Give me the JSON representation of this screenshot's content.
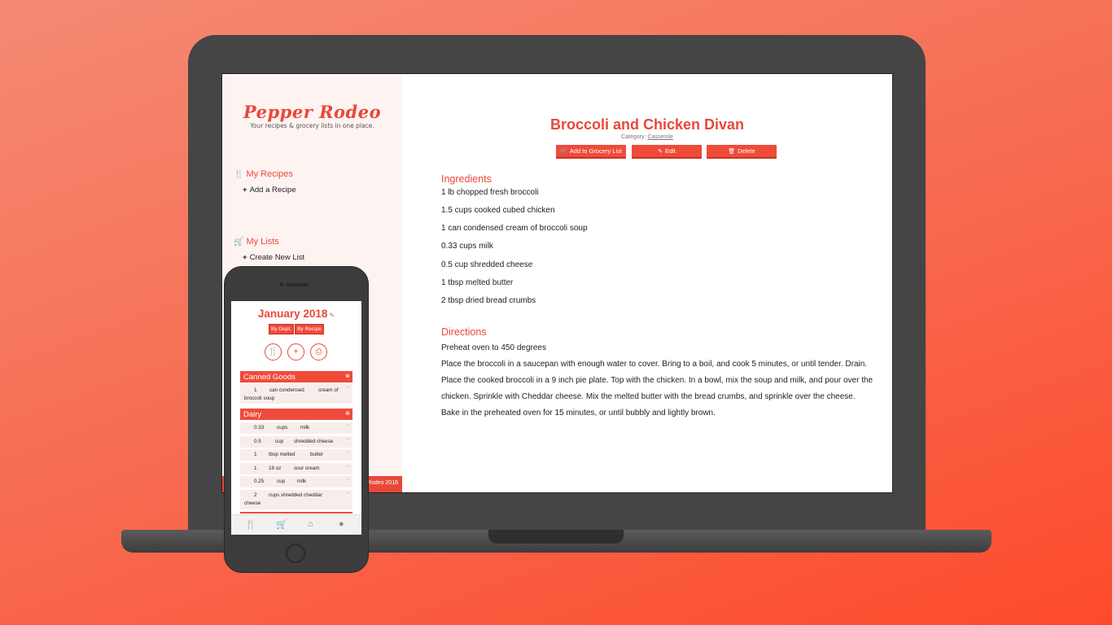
{
  "desktop": {
    "logo": "Pepper Rodeo",
    "tagline": "Your recipes & grocery lists in one place.",
    "sidebar": {
      "recipes_heading": "My Recipes",
      "add_recipe": "Add a Recipe",
      "lists_heading": "My Lists",
      "create_list": "Create New List"
    },
    "footer": "Rodeo 2016",
    "recipe": {
      "title": "Broccoli and Chicken Divan",
      "category_label": "Category:",
      "category_value": "Casserole",
      "buttons": {
        "add_to_list": "Add to Grocery List",
        "edit": "Edit",
        "delete": "Delete"
      },
      "ingredients_heading": "Ingredients",
      "ingredients": [
        "1 lb chopped fresh broccoli",
        "1.5 cups cooked cubed chicken",
        "1 can condensed cream of broccoli soup",
        "0.33 cups milk",
        "0.5 cup shredded cheese",
        "1 tbsp melted butter",
        "2 tbsp dried bread crumbs"
      ],
      "directions_heading": "Directions",
      "directions": [
        "Preheat oven to 450 degrees",
        "Place the broccoli in a saucepan with enough water to cover. Bring to a boil, and cook 5 minutes, or until tender. Drain.",
        "Place the cooked broccoli in a 9 inch pie plate. Top with the chicken. In a bowl, mix the soup and milk, and pour over the",
        "chicken. Sprinkle with Cheddar cheese. Mix the melted butter with the bread crumbs, and sprinkle over the cheese.",
        "Bake in the preheated oven for 15 minutes, or until bubbly and lightly brown."
      ]
    }
  },
  "mobile": {
    "title": "January 2018",
    "tabs": [
      "By Dept.",
      "By Recipe"
    ],
    "departments": [
      {
        "name": "Canned Goods",
        "items": [
          {
            "qty": "1",
            "unit": "can condensed",
            "name": "cream of",
            "name2": "broccoli soup"
          }
        ]
      },
      {
        "name": "Dairy",
        "items": [
          {
            "qty": "0.33",
            "unit": "cups",
            "name": "milk"
          },
          {
            "qty": "0.5",
            "unit": "cup",
            "name": "shredded cheese"
          },
          {
            "qty": "1",
            "unit": "tbsp melted",
            "name": "butter"
          },
          {
            "qty": "1",
            "unit": "16 oz",
            "name": "sour cream"
          },
          {
            "qty": "0.25",
            "unit": "cup",
            "name": "milk"
          },
          {
            "qty": "2",
            "unit": "cups shredded cheddar",
            "name": "",
            "name2": "cheese"
          }
        ]
      }
    ]
  },
  "colors": {
    "accent": "#e8483a",
    "button": "#ef4b3a",
    "sidebar_bg": "#fdf4f2",
    "laptop_body": "#454545"
  }
}
